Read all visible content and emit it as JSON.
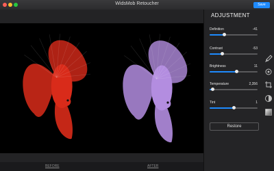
{
  "window": {
    "title": "WidsMob Retoucher",
    "save_label": "Save"
  },
  "panel": {
    "title": "ADJUSTMENT",
    "adjustments": [
      {
        "key": "definition",
        "label": "Definition",
        "value": "-41",
        "level": 0.3
      },
      {
        "key": "contrast",
        "label": "Contrast",
        "value": "-53",
        "level": 0.25
      },
      {
        "key": "brightness",
        "label": "Brightness",
        "value": "11",
        "level": 0.55
      },
      {
        "key": "temperature",
        "label": "Temperature",
        "value": "2,356",
        "level": 0.06
      },
      {
        "key": "tint",
        "label": "Tint",
        "value": "1",
        "level": 0.5
      }
    ],
    "restore_label": "Restore"
  },
  "compare": {
    "before_label": "BEFORE",
    "after_label": "AFTER"
  },
  "images": {
    "before_color": "#d92b1a",
    "after_color": "#b38de0"
  },
  "toolbar": {
    "icons": [
      "brush-icon",
      "lens-icon",
      "crop-icon",
      "adjust-icon",
      "gradient-icon"
    ]
  }
}
